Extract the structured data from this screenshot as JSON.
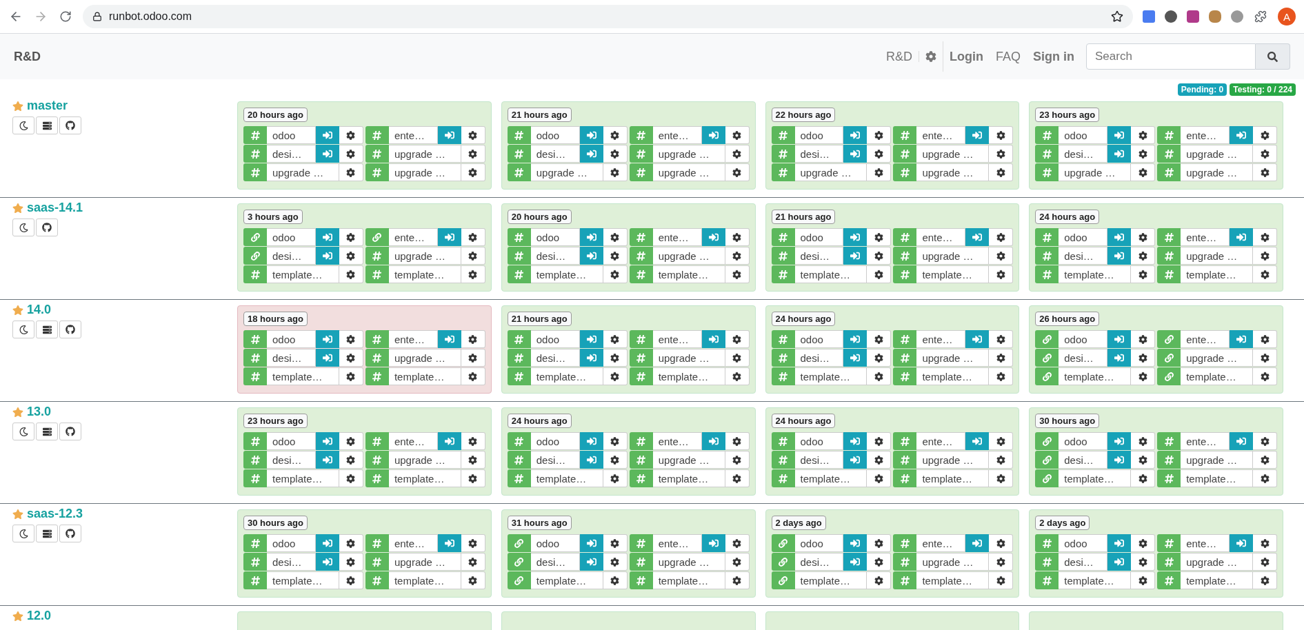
{
  "browser": {
    "url": "runbot.odoo.com",
    "profile": "A"
  },
  "navbar": {
    "brand": "R&D",
    "links": [
      {
        "kind": "text",
        "label": "R&D"
      },
      {
        "kind": "gear"
      },
      {
        "kind": "bold",
        "label": "Login"
      },
      {
        "kind": "text",
        "label": "FAQ"
      },
      {
        "kind": "bold",
        "label": "Sign in"
      }
    ],
    "search": {
      "placeholder": "Search"
    }
  },
  "counters": [
    {
      "label": "Pending: 0",
      "color": "#17a2b8"
    },
    {
      "label": "Testing: 0 / 224",
      "color": "#28a745"
    }
  ],
  "branches": [
    {
      "name": "master",
      "tools": [
        {
          "kind": "moon"
        },
        {
          "kind": "server"
        },
        {
          "kind": "github"
        }
      ],
      "batches": [
        {
          "age": "20 hours ago",
          "failed": false,
          "slots": [
            {
              "kind": "hash",
              "label": "odoo",
              "connect": true
            },
            {
              "kind": "hash",
              "label": "ente…",
              "connect": true
            },
            {
              "kind": "hash",
              "label": "desi…",
              "connect": true
            },
            {
              "kind": "hash",
              "label": "upgrade …",
              "connect": false
            },
            {
              "kind": "hash",
              "label": "upgrade …",
              "connect": false
            },
            {
              "kind": "hash",
              "label": "upgrade …",
              "connect": false
            }
          ]
        },
        {
          "age": "21 hours ago",
          "failed": false,
          "slots": [
            {
              "kind": "hash",
              "label": "odoo",
              "connect": true
            },
            {
              "kind": "hash",
              "label": "ente…",
              "connect": true
            },
            {
              "kind": "hash",
              "label": "desi…",
              "connect": true
            },
            {
              "kind": "hash",
              "label": "upgrade …",
              "connect": false
            },
            {
              "kind": "hash",
              "label": "upgrade …",
              "connect": false
            },
            {
              "kind": "hash",
              "label": "upgrade …",
              "connect": false
            }
          ]
        },
        {
          "age": "22 hours ago",
          "failed": false,
          "slots": [
            {
              "kind": "hash",
              "label": "odoo",
              "connect": true
            },
            {
              "kind": "hash",
              "label": "ente…",
              "connect": true
            },
            {
              "kind": "hash",
              "label": "desi…",
              "connect": true
            },
            {
              "kind": "hash",
              "label": "upgrade …",
              "connect": false
            },
            {
              "kind": "hash",
              "label": "upgrade …",
              "connect": false
            },
            {
              "kind": "hash",
              "label": "upgrade …",
              "connect": false
            }
          ]
        },
        {
          "age": "23 hours ago",
          "failed": false,
          "slots": [
            {
              "kind": "hash",
              "label": "odoo",
              "connect": true
            },
            {
              "kind": "hash",
              "label": "ente…",
              "connect": true
            },
            {
              "kind": "hash",
              "label": "desi…",
              "connect": true
            },
            {
              "kind": "hash",
              "label": "upgrade …",
              "connect": false
            },
            {
              "kind": "hash",
              "label": "upgrade …",
              "connect": false
            },
            {
              "kind": "hash",
              "label": "upgrade …",
              "connect": false
            }
          ]
        }
      ]
    },
    {
      "name": "saas-14.1",
      "tools": [
        {
          "kind": "moon"
        },
        {
          "kind": "github"
        }
      ],
      "batches": [
        {
          "age": "3 hours ago",
          "failed": false,
          "slots": [
            {
              "kind": "link",
              "label": "odoo",
              "connect": true
            },
            {
              "kind": "link",
              "label": "ente…",
              "connect": true
            },
            {
              "kind": "link",
              "label": "desi…",
              "connect": true
            },
            {
              "kind": "hash",
              "label": "upgrade …",
              "connect": false
            },
            {
              "kind": "hash",
              "label": "template…",
              "connect": false
            },
            {
              "kind": "hash",
              "label": "template…",
              "connect": false
            }
          ]
        },
        {
          "age": "20 hours ago",
          "failed": false,
          "slots": [
            {
              "kind": "hash",
              "label": "odoo",
              "connect": true
            },
            {
              "kind": "hash",
              "label": "ente…",
              "connect": true
            },
            {
              "kind": "hash",
              "label": "desi…",
              "connect": true
            },
            {
              "kind": "hash",
              "label": "upgrade …",
              "connect": false
            },
            {
              "kind": "hash",
              "label": "template…",
              "connect": false
            },
            {
              "kind": "hash",
              "label": "template…",
              "connect": false
            }
          ]
        },
        {
          "age": "21 hours ago",
          "failed": false,
          "slots": [
            {
              "kind": "hash",
              "label": "odoo",
              "connect": true
            },
            {
              "kind": "hash",
              "label": "ente…",
              "connect": true
            },
            {
              "kind": "hash",
              "label": "desi…",
              "connect": true
            },
            {
              "kind": "hash",
              "label": "upgrade …",
              "connect": false
            },
            {
              "kind": "hash",
              "label": "template…",
              "connect": false
            },
            {
              "kind": "hash",
              "label": "template…",
              "connect": false
            }
          ]
        },
        {
          "age": "24 hours ago",
          "failed": false,
          "slots": [
            {
              "kind": "hash",
              "label": "odoo",
              "connect": true
            },
            {
              "kind": "hash",
              "label": "ente…",
              "connect": true
            },
            {
              "kind": "hash",
              "label": "desi…",
              "connect": true
            },
            {
              "kind": "hash",
              "label": "upgrade …",
              "connect": false
            },
            {
              "kind": "hash",
              "label": "template…",
              "connect": false
            },
            {
              "kind": "hash",
              "label": "template…",
              "connect": false
            }
          ]
        }
      ]
    },
    {
      "name": "14.0",
      "tools": [
        {
          "kind": "moon"
        },
        {
          "kind": "server"
        },
        {
          "kind": "github"
        }
      ],
      "batches": [
        {
          "age": "18 hours ago",
          "failed": true,
          "slots": [
            {
              "kind": "hash",
              "label": "odoo",
              "connect": true
            },
            {
              "kind": "hash",
              "label": "ente…",
              "connect": true
            },
            {
              "kind": "hash",
              "label": "desi…",
              "connect": true
            },
            {
              "kind": "hash",
              "label": "upgrade …",
              "connect": false
            },
            {
              "kind": "hash",
              "label": "template…",
              "connect": false
            },
            {
              "kind": "hash",
              "label": "template…",
              "connect": false
            }
          ]
        },
        {
          "age": "21 hours ago",
          "failed": false,
          "slots": [
            {
              "kind": "hash",
              "label": "odoo",
              "connect": true
            },
            {
              "kind": "hash",
              "label": "ente…",
              "connect": true
            },
            {
              "kind": "hash",
              "label": "desi…",
              "connect": true
            },
            {
              "kind": "hash",
              "label": "upgrade …",
              "connect": false
            },
            {
              "kind": "hash",
              "label": "template…",
              "connect": false
            },
            {
              "kind": "hash",
              "label": "template…",
              "connect": false
            }
          ]
        },
        {
          "age": "24 hours ago",
          "failed": false,
          "slots": [
            {
              "kind": "hash",
              "label": "odoo",
              "connect": true
            },
            {
              "kind": "hash",
              "label": "ente…",
              "connect": true
            },
            {
              "kind": "hash",
              "label": "desi…",
              "connect": true
            },
            {
              "kind": "hash",
              "label": "upgrade …",
              "connect": false
            },
            {
              "kind": "hash",
              "label": "template…",
              "connect": false
            },
            {
              "kind": "hash",
              "label": "template…",
              "connect": false
            }
          ]
        },
        {
          "age": "26 hours ago",
          "failed": false,
          "slots": [
            {
              "kind": "link",
              "label": "odoo",
              "connect": true
            },
            {
              "kind": "link",
              "label": "ente…",
              "connect": true
            },
            {
              "kind": "link",
              "label": "desi…",
              "connect": true
            },
            {
              "kind": "link",
              "label": "upgrade …",
              "connect": false
            },
            {
              "kind": "link",
              "label": "template…",
              "connect": false
            },
            {
              "kind": "link",
              "label": "template…",
              "connect": false
            }
          ]
        }
      ]
    },
    {
      "name": "13.0",
      "tools": [
        {
          "kind": "moon"
        },
        {
          "kind": "server"
        },
        {
          "kind": "github"
        }
      ],
      "batches": [
        {
          "age": "23 hours ago",
          "failed": false,
          "slots": [
            {
              "kind": "hash",
              "label": "odoo",
              "connect": true
            },
            {
              "kind": "hash",
              "label": "ente…",
              "connect": true
            },
            {
              "kind": "hash",
              "label": "desi…",
              "connect": true
            },
            {
              "kind": "hash",
              "label": "upgrade …",
              "connect": false
            },
            {
              "kind": "hash",
              "label": "template…",
              "connect": false
            },
            {
              "kind": "hash",
              "label": "template…",
              "connect": false
            }
          ]
        },
        {
          "age": "24 hours ago",
          "failed": false,
          "slots": [
            {
              "kind": "hash",
              "label": "odoo",
              "connect": true
            },
            {
              "kind": "hash",
              "label": "ente…",
              "connect": true
            },
            {
              "kind": "hash",
              "label": "desi…",
              "connect": true
            },
            {
              "kind": "hash",
              "label": "upgrade …",
              "connect": false
            },
            {
              "kind": "hash",
              "label": "template…",
              "connect": false
            },
            {
              "kind": "hash",
              "label": "template…",
              "connect": false
            }
          ]
        },
        {
          "age": "24 hours ago",
          "failed": false,
          "slots": [
            {
              "kind": "hash",
              "label": "odoo",
              "connect": true
            },
            {
              "kind": "hash",
              "label": "ente…",
              "connect": true
            },
            {
              "kind": "hash",
              "label": "desi…",
              "connect": true
            },
            {
              "kind": "hash",
              "label": "upgrade …",
              "connect": false
            },
            {
              "kind": "hash",
              "label": "template…",
              "connect": false
            },
            {
              "kind": "hash",
              "label": "template…",
              "connect": false
            }
          ]
        },
        {
          "age": "30 hours ago",
          "failed": false,
          "slots": [
            {
              "kind": "link",
              "label": "odoo",
              "connect": true
            },
            {
              "kind": "hash",
              "label": "ente…",
              "connect": true
            },
            {
              "kind": "link",
              "label": "desi…",
              "connect": true
            },
            {
              "kind": "hash",
              "label": "upgrade …",
              "connect": false
            },
            {
              "kind": "link",
              "label": "template…",
              "connect": false
            },
            {
              "kind": "hash",
              "label": "template…",
              "connect": false
            }
          ]
        }
      ]
    },
    {
      "name": "saas-12.3",
      "tools": [
        {
          "kind": "moon"
        },
        {
          "kind": "server"
        },
        {
          "kind": "github"
        }
      ],
      "batches": [
        {
          "age": "30 hours ago",
          "failed": false,
          "slots": [
            {
              "kind": "hash",
              "label": "odoo",
              "connect": true
            },
            {
              "kind": "hash",
              "label": "ente…",
              "connect": true
            },
            {
              "kind": "hash",
              "label": "desi…",
              "connect": true
            },
            {
              "kind": "hash",
              "label": "upgrade …",
              "connect": false
            },
            {
              "kind": "hash",
              "label": "template…",
              "connect": false
            },
            {
              "kind": "hash",
              "label": "template…",
              "connect": false
            }
          ]
        },
        {
          "age": "31 hours ago",
          "failed": false,
          "slots": [
            {
              "kind": "link",
              "label": "odoo",
              "connect": true
            },
            {
              "kind": "hash",
              "label": "ente…",
              "connect": true
            },
            {
              "kind": "link",
              "label": "desi…",
              "connect": true
            },
            {
              "kind": "hash",
              "label": "upgrade …",
              "connect": false
            },
            {
              "kind": "link",
              "label": "template…",
              "connect": false
            },
            {
              "kind": "hash",
              "label": "template…",
              "connect": false
            }
          ]
        },
        {
          "age": "2 days ago",
          "failed": false,
          "slots": [
            {
              "kind": "link",
              "label": "odoo",
              "connect": true
            },
            {
              "kind": "hash",
              "label": "ente…",
              "connect": true
            },
            {
              "kind": "link",
              "label": "desi…",
              "connect": true
            },
            {
              "kind": "hash",
              "label": "upgrade …",
              "connect": false
            },
            {
              "kind": "link",
              "label": "template…",
              "connect": false
            },
            {
              "kind": "hash",
              "label": "template…",
              "connect": false
            }
          ]
        },
        {
          "age": "2 days ago",
          "failed": false,
          "slots": [
            {
              "kind": "hash",
              "label": "odoo",
              "connect": true
            },
            {
              "kind": "hash",
              "label": "ente…",
              "connect": true
            },
            {
              "kind": "hash",
              "label": "desi…",
              "connect": true
            },
            {
              "kind": "hash",
              "label": "upgrade …",
              "connect": false
            },
            {
              "kind": "hash",
              "label": "template…",
              "connect": false
            },
            {
              "kind": "hash",
              "label": "template…",
              "connect": false
            }
          ]
        }
      ]
    },
    {
      "name": "12.0",
      "batches": [
        {
          "failed": false
        },
        {
          "failed": false
        },
        {
          "failed": false
        },
        {
          "failed": false
        }
      ]
    }
  ]
}
